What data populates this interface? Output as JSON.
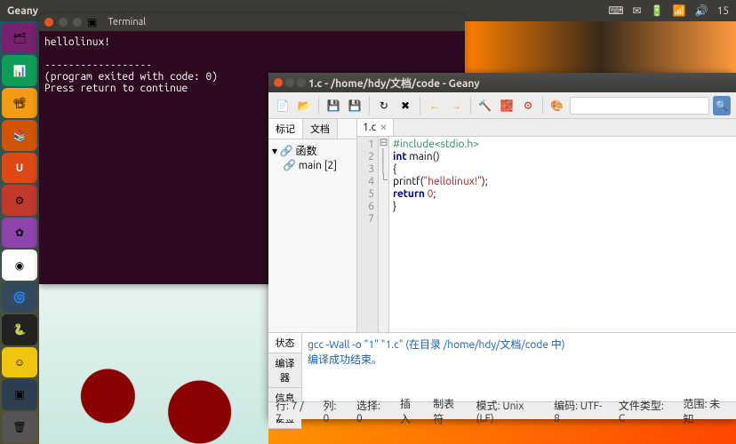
{
  "menubar": {
    "title": "Geany",
    "clock": "15"
  },
  "launcher": {
    "items": [
      {
        "name": "files",
        "glyph": "🗂"
      },
      {
        "name": "calc",
        "glyph": "📊"
      },
      {
        "name": "impress",
        "glyph": "📽"
      },
      {
        "name": "books",
        "glyph": "📚"
      },
      {
        "name": "software-center",
        "glyph": "U"
      },
      {
        "name": "settings",
        "glyph": "⚙"
      },
      {
        "name": "app",
        "glyph": "✿"
      },
      {
        "name": "chrome",
        "glyph": "◉"
      },
      {
        "name": "lens",
        "glyph": "🌀"
      },
      {
        "name": "python",
        "glyph": "🐍"
      },
      {
        "name": "app2",
        "glyph": "☺"
      },
      {
        "name": "terminal",
        "glyph": "▣"
      },
      {
        "name": "trash",
        "glyph": "🗑"
      }
    ]
  },
  "terminal": {
    "title": "Terminal",
    "output": "hellolinux!\n\n------------------\n(program exited with code: 0)\nPress return to continue\n"
  },
  "geany": {
    "title": "1.c - /home/hdy/文档/code - Geany",
    "sidebar": {
      "tabs": [
        "标记",
        "文档"
      ],
      "tree_root": "函数",
      "tree_child": "main [2]"
    },
    "editor": {
      "tab": "1.c",
      "lines": [
        "1",
        "2",
        "3",
        "4",
        "5",
        "6",
        "7"
      ],
      "fold": [
        "",
        "",
        "⊟",
        "│",
        "│",
        "└",
        ""
      ],
      "code": {
        "l1_pp": "#include<stdio.h>",
        "l2_kw": "int",
        "l2_rest": " main()",
        "l3": "{",
        "l4a": "printf(",
        "l4_str": "\"hellolinux!\"",
        "l4b": ");",
        "l5_kw": "return",
        "l5_sp": " ",
        "l5_num": "0",
        "l5_semi": ";",
        "l6": "}",
        "l7": ""
      }
    },
    "bottom": {
      "tabs": [
        "状态",
        "编译器",
        "信息",
        "便签"
      ],
      "line1": "gcc -Wall -o \"1\" \"1.c\" (在目录 /home/hdy/文档/code 中)",
      "line2": "编译成功结束。"
    },
    "status": {
      "line": "行: 7 / 7",
      "col": "列: 0",
      "sel": "选择: 0",
      "ins": "插入",
      "tab": "制表符",
      "mode": "模式: Unix (LF)",
      "enc": "编码: UTF-8",
      "ft": "文件类型: C",
      "scope": "范围: 未知"
    },
    "search_placeholder": ""
  }
}
